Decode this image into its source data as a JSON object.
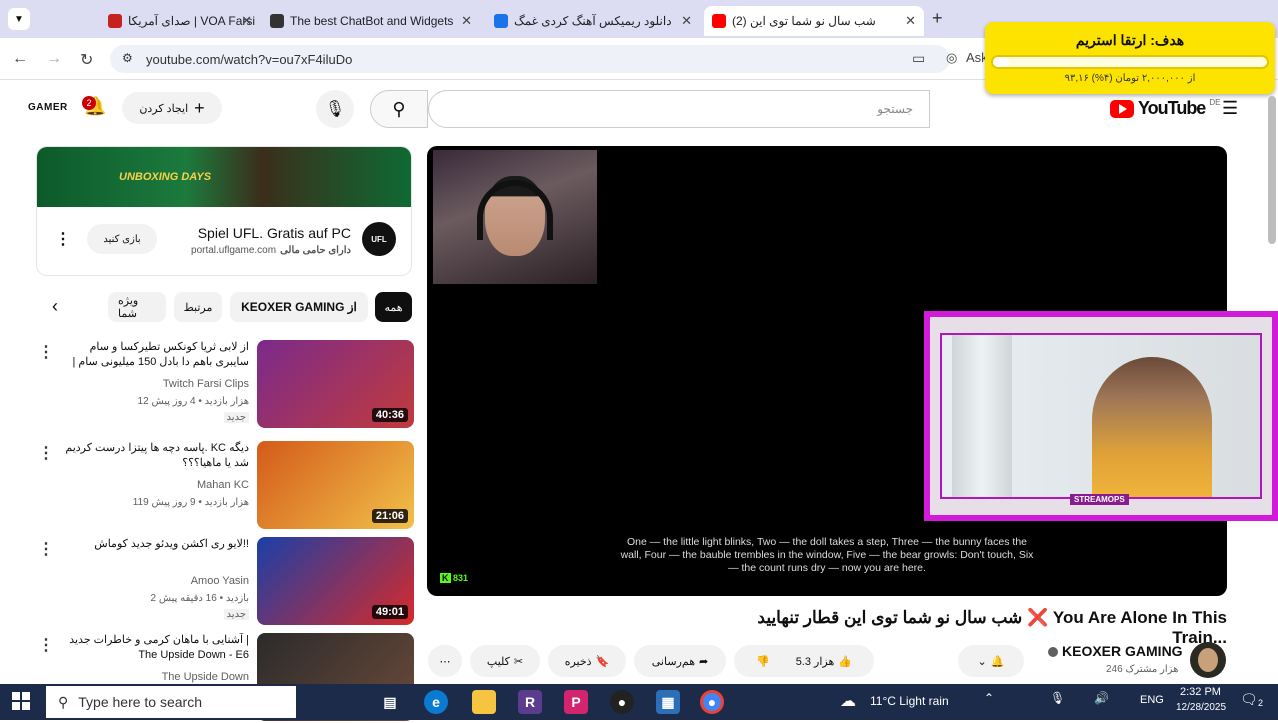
{
  "tabs": [
    {
      "title": "صدای آمریکا | VOA Farsi",
      "color": "#c5221f"
    },
    {
      "title": "The best ChatBot and Widgets",
      "color": "#333"
    },
    {
      "title": "دانلود ریمیکس آهنگ کردی غمگ",
      "color": "#1a73e8"
    },
    {
      "title": "(2) شب سال نو شما توی این",
      "color": "#ff0000"
    }
  ],
  "browser": {
    "url": "youtube.com/watch?v=ou7xF4iluDo",
    "ask_label": "Ask"
  },
  "goal_widget": {
    "title": "هدف: ارتقا استریم",
    "progress_label": "۹۳,۱۶ از ۲,۰۰۰,۰۰۰ تومان (۴%)",
    "progress_fraction": 0.04,
    "accent": "#fde300"
  },
  "youtube_header": {
    "logo_text": "YouTube",
    "logo_cc": "DE",
    "search_placeholder": "جستجو",
    "create_label": "ایجاد کردن",
    "notification_count": "2",
    "user_label": "GAMER"
  },
  "ad": {
    "banner_text": "UNBOXING DAYS",
    "title": "Spiel UFL. Gratis auf PC",
    "sponsor": "دارای حامی مالی",
    "domain": "portal.uflgame.com",
    "logo_text": "UFL",
    "button_label": "بازی کنید"
  },
  "chips": [
    {
      "label": "همه",
      "active": true
    },
    {
      "label": "KEOXER GAMING از",
      "active": false
    },
    {
      "label": "مرتبط",
      "active": false
    },
    {
      "label": "ویژه شما",
      "active": false
    }
  ],
  "recommendations": [
    {
      "title": "از لابی ثریا کونکس تطیرکسا و سام سایبری باهم دا بادل 150 میلیونی سام | کونکس + ...",
      "channel": "Twitch Farsi Clips",
      "meta": "12 هزار بازدید • 4 روز پیش",
      "badge": "جدید",
      "duration": "40:36",
      "thumb_colors": [
        "#7b2a8c",
        "#c13b3b"
      ]
    },
    {
      "title": "پاسه دچه ها پیتزا درست کردیم. KC دیگه شد یا ماهیا؟؟؟",
      "channel": "Mahan KC",
      "meta": "119 هزار بازدید • 9 روز پیش",
      "badge": "",
      "duration": "21:06",
      "thumb_colors": [
        "#d35a1a",
        "#f2c14a"
      ]
    },
    {
      "title": "لایو ری اکشن ویدئو جدید کوماش!!",
      "channel": "Amoo Yasin",
      "meta": "2 بازدید • 16 دقیقه پیش",
      "badge": "جدید",
      "duration": "49:01",
      "thumb_colors": [
        "#1a3fa8",
        "#d82a2a"
      ]
    },
    {
      "title": "آشنایی با ماهان کرمی و خاطرات جدید | The Upside Down - E6",
      "channel": "The Upside Down",
      "meta": "",
      "badge": "",
      "duration": "",
      "thumb_colors": [
        "#2b2b2b",
        "#6b4a3a"
      ]
    }
  ],
  "video": {
    "captions": "One — the little light blinks, Two — the doll takes a step, Three — the bunny faces the wall, Four — the bauble trembles in the window, Five — the bear growls: Don't touch, Six — the count runs dry — now you are here.",
    "kick_viewers": "831",
    "overlay_label": "STREAMOPS",
    "title": "شب سال نو شما توی این قطار تنهایید ❌ You Are Alone In This Train...",
    "channel_name": "KEOXER GAMING",
    "subscribers": "246 هزار مشترک",
    "likes": "5.3 هزار",
    "share_label": "هم‌رسانی",
    "save_label": "ذخیره",
    "clip_label": "کلیپ"
  },
  "taskbar": {
    "search_placeholder": "Type here to search",
    "weather": "11°C  Light rain",
    "lang": "ENG",
    "time": "2:32 PM",
    "date": "12/28/2025",
    "notif_count": "2"
  }
}
